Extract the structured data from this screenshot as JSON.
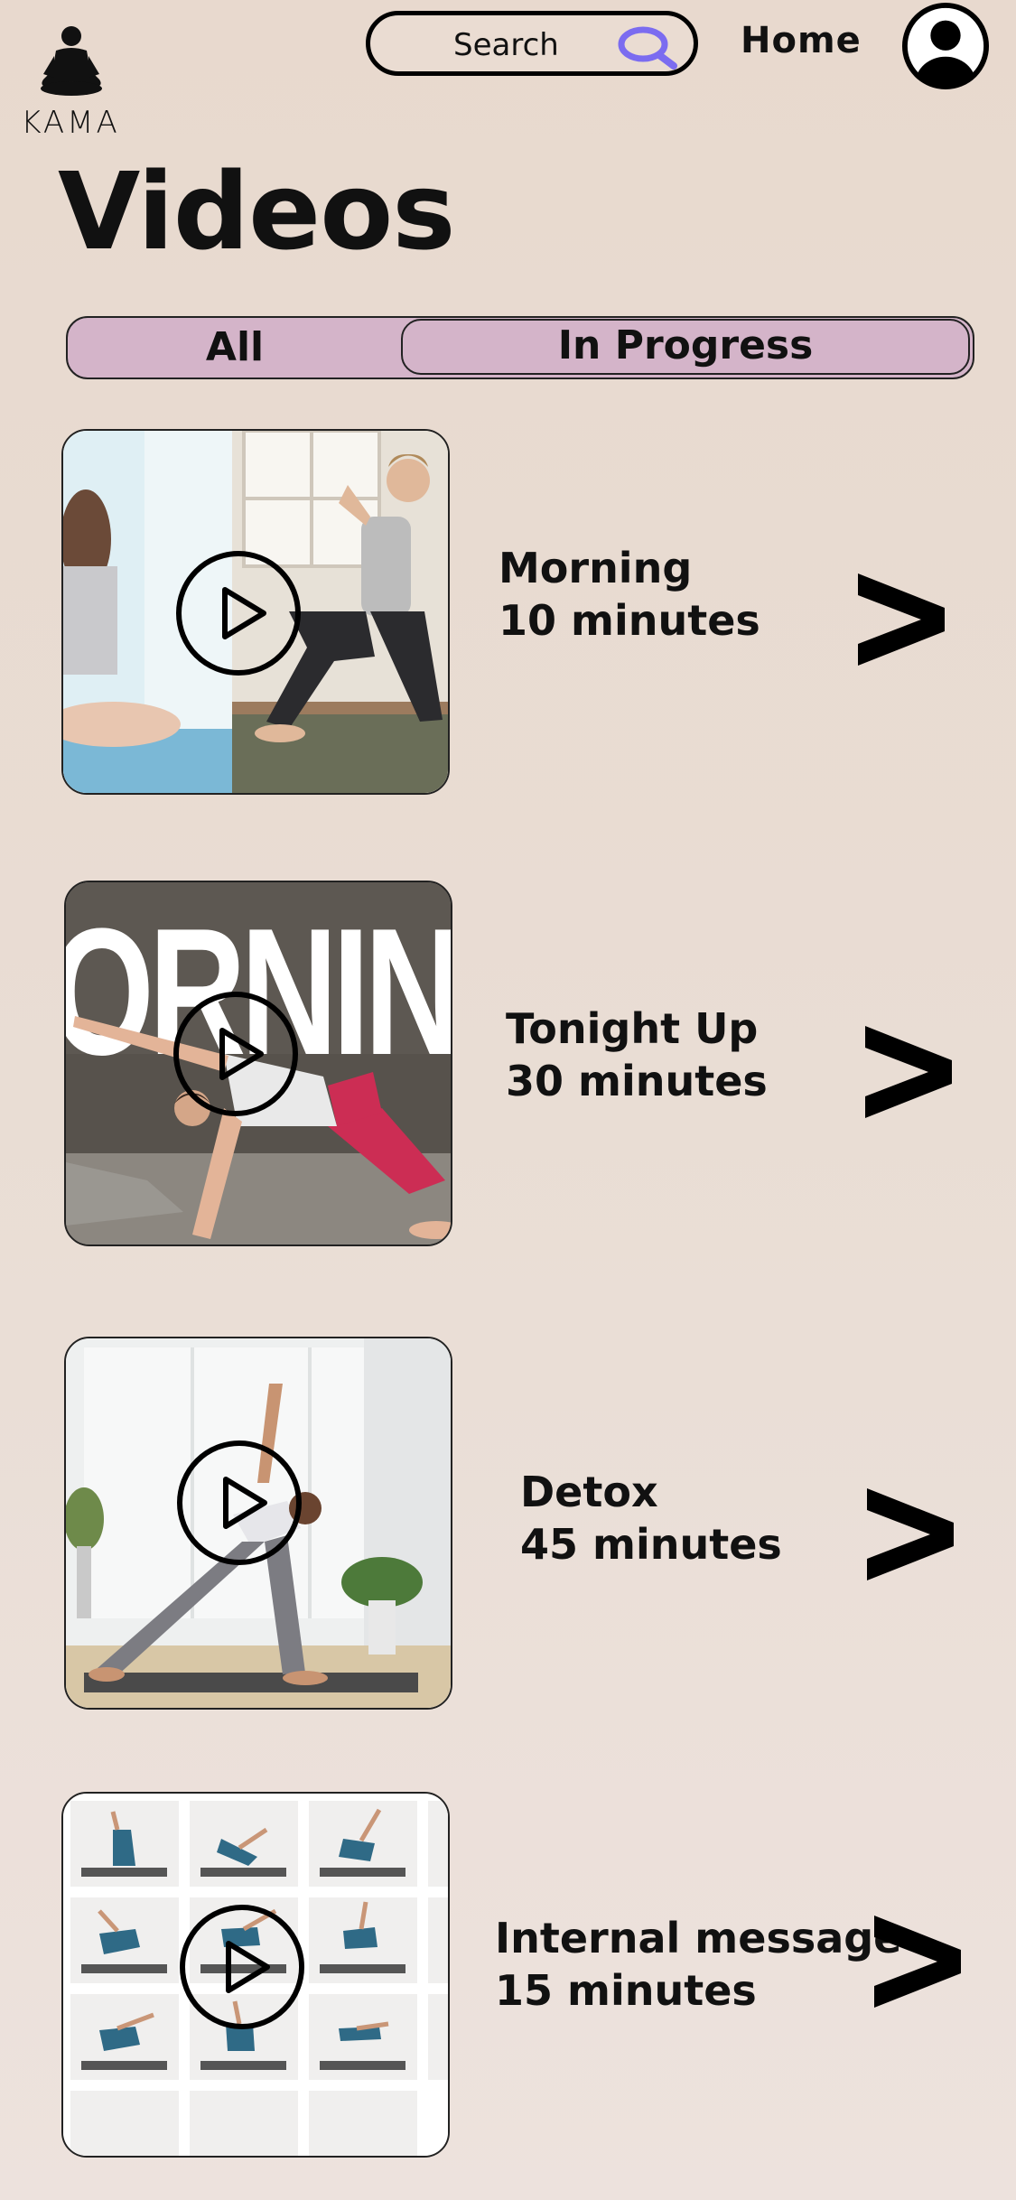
{
  "header": {
    "logo_text": "KAMA",
    "search_label": "Search",
    "home_label": "Home"
  },
  "page": {
    "title": "Videos"
  },
  "tabs": [
    {
      "label": "All"
    },
    {
      "label": "In Progress"
    }
  ],
  "videos": [
    {
      "title": "Morning",
      "duration": "10 minutes"
    },
    {
      "title": "Tonight Up",
      "duration": "30 minutes"
    },
    {
      "title": "Detox",
      "duration": "45 minutes"
    },
    {
      "title": "Internal message",
      "duration": "15 minutes"
    }
  ],
  "thumbnail_text": {
    "video_2_overlay": "ORNIN"
  },
  "colors": {
    "background": "#e9ddd4",
    "tab_fill": "#d4b4c9",
    "search_icon": "#7b6cf0",
    "text": "#111111"
  },
  "icons": {
    "logo": "meditation-figure-icon",
    "search": "magnifier-icon",
    "avatar": "user-avatar-icon",
    "play": "play-icon",
    "chevron": "chevron-right-icon"
  }
}
